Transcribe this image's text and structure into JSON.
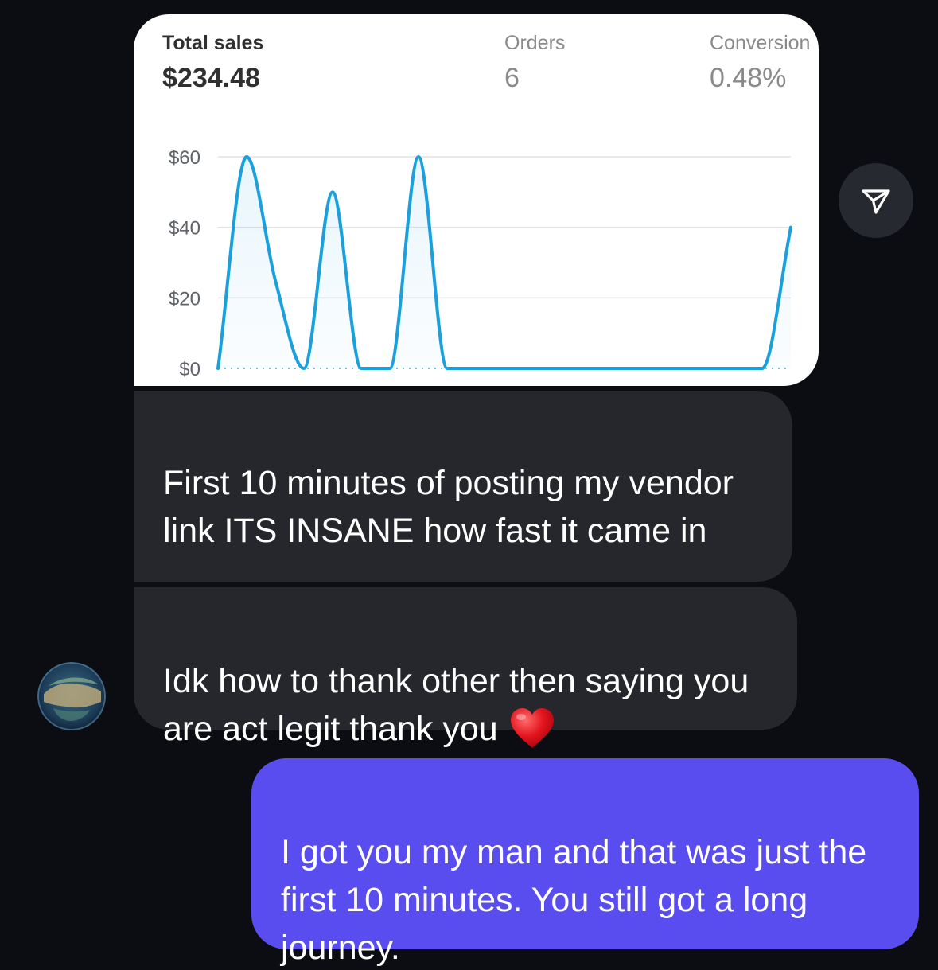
{
  "shared_image": {
    "stats": {
      "total_sales_label": "Total sales",
      "total_sales_value": "$234.48",
      "orders_label": "Orders",
      "orders_value": "6",
      "conversion_label": "Conversion",
      "conversion_value": "0.48%"
    }
  },
  "chart_data": {
    "type": "area",
    "title": "",
    "xlabel": "",
    "ylabel": "",
    "y_ticks": [
      "$0",
      "$20",
      "$40",
      "$60"
    ],
    "y_tick_values": [
      0,
      20,
      40,
      60
    ],
    "ylim": [
      0,
      60
    ],
    "grid": true,
    "line_color": "#1aa0dc",
    "x": [
      0,
      1,
      2,
      3,
      4,
      5,
      6,
      7,
      8,
      9,
      10,
      11,
      12,
      13,
      14,
      15,
      16,
      17,
      18,
      19,
      20
    ],
    "series": [
      {
        "values": [
          0,
          60,
          25,
          0,
          50,
          0,
          0,
          60,
          0,
          0,
          0,
          0,
          0,
          0,
          0,
          0,
          0,
          0,
          0,
          0,
          40
        ]
      }
    ]
  },
  "messages": [
    {
      "sender": "contact",
      "text": "First 10 minutes of posting my vendor link ITS INSANE how fast it came in"
    },
    {
      "sender": "contact",
      "text": "Idk how to thank other then saying you are act legit thank you",
      "emoji": "red-heart"
    },
    {
      "sender": "me",
      "text": "I got you my man and that was just the first 10 minutes. You still got a long journey."
    }
  ],
  "colors": {
    "background": "#0b0d12",
    "incoming_bubble": "#25272c",
    "outgoing_bubble": "#5a4df0",
    "share_button": "#26292f"
  },
  "icons": {
    "share": "paper-plane-icon",
    "avatar": "globe-avatar",
    "heart": "red-heart-emoji"
  }
}
